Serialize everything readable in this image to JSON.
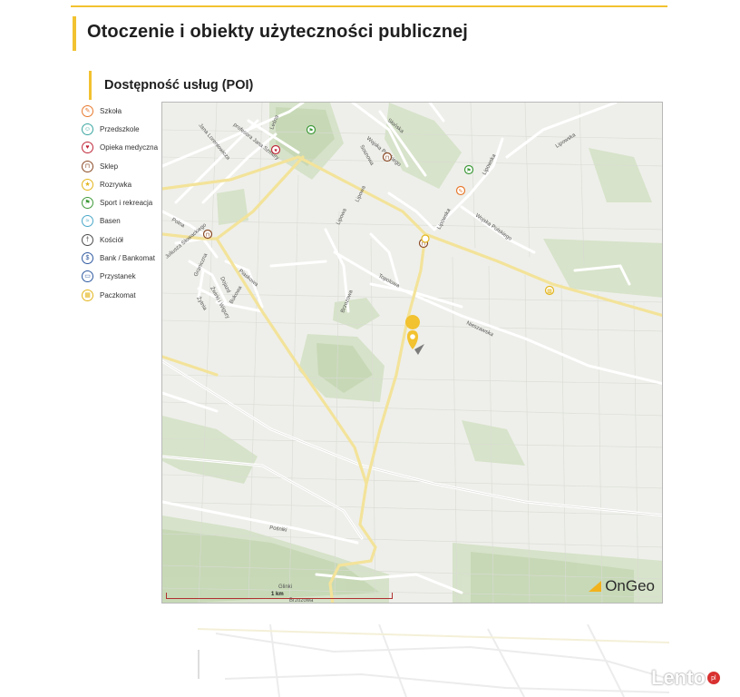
{
  "header": {
    "title": "Otoczenie i obiekty użyteczności publicznej",
    "subtitle": "Dostępność usług (POI)"
  },
  "legend": [
    {
      "label": "Szkoła",
      "icon": "school-icon",
      "color": "#e8792e",
      "glyph": "✎"
    },
    {
      "label": "Przedszkole",
      "icon": "kindergarten-icon",
      "color": "#3aa6a0",
      "glyph": "☺"
    },
    {
      "label": "Opieka medyczna",
      "icon": "medical-icon",
      "color": "#c0283a",
      "glyph": "♥"
    },
    {
      "label": "Sklep",
      "icon": "shop-icon",
      "color": "#8b4a26",
      "glyph": "⊓"
    },
    {
      "label": "Rozrywka",
      "icon": "entertainment-icon",
      "color": "#e3b51c",
      "glyph": "★"
    },
    {
      "label": "Sport i rekreacja",
      "icon": "sport-icon",
      "color": "#3f9a3a",
      "glyph": "⚑"
    },
    {
      "label": "Basen",
      "icon": "pool-icon",
      "color": "#4aa8c8",
      "glyph": "≈"
    },
    {
      "label": "Kościół",
      "icon": "church-icon",
      "color": "#4d4d4d",
      "glyph": "†"
    },
    {
      "label": "Bank / Bankomat",
      "icon": "bank-icon",
      "color": "#2f5aa0",
      "glyph": "$"
    },
    {
      "label": "Przystanek",
      "icon": "bus-stop-icon",
      "color": "#2f5aa0",
      "glyph": "▭"
    },
    {
      "label": "Paczkomat",
      "icon": "parcel-locker-icon",
      "color": "#e3b51c",
      "glyph": "▦"
    }
  ],
  "map": {
    "streets": {
      "lesna": "Leśna",
      "slonska": "Słońska",
      "lipowska": "Lipowska",
      "profesora": "profesora Jana Szmury",
      "lorentowicza": "Jana Lorentowicza",
      "wojska1": "Wojska Polskiego",
      "wojska2": "Wojska Polskiego",
      "sosnowa": "Sosnowa",
      "lipowa1": "Lipowa",
      "lipowa2": "Lipowa",
      "lipowska2": "Lipowska",
      "polna": "Polna",
      "slowackiego": "Juliusza Słowackiego",
      "graniczna": "Graniczna",
      "piaskowa": "Piaskowa",
      "dojazd": "Dojazd",
      "zwirkiwigury": "Żwirki i Wigury",
      "bukowa": "Bukowa",
      "zytnia": "Żytnia",
      "brzozowa1": "Brzozowa",
      "topolowa": "Topolowa",
      "nieszawska": "Nieszawska",
      "polniki": "Pośniki",
      "glinki": "Glinki",
      "brzozowa2": "Brzozowa",
      "lipowska3": "Lipowska"
    },
    "scale_label": "1 km",
    "brand": "OnGeo"
  },
  "watermark": {
    "text": "Lento",
    "badge": "pl"
  }
}
